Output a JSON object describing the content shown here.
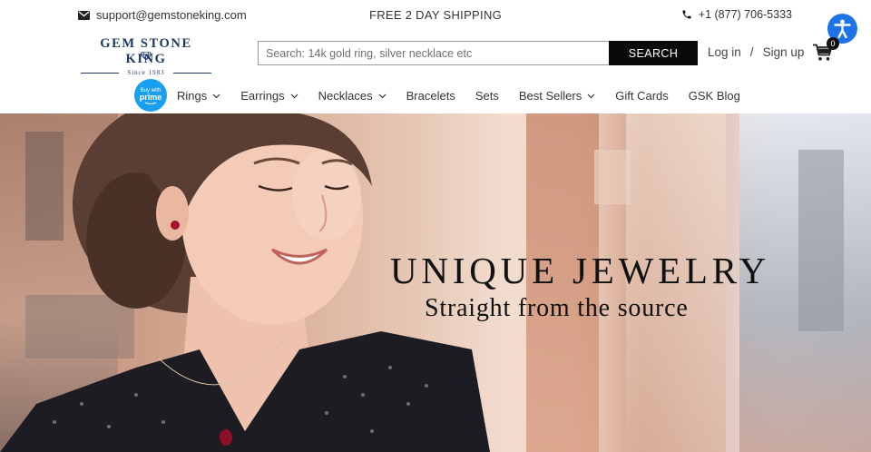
{
  "topbar": {
    "email": "support@gemstoneking.com",
    "shipping": "FREE 2 DAY SHIPPING",
    "phone": "+1 (877) 706-5333"
  },
  "logo": {
    "name": "GEM STONE KING",
    "since": "Since 1983"
  },
  "search": {
    "placeholder": "Search: 14k gold ring, silver necklace etc",
    "button": "SEARCH"
  },
  "account": {
    "login": "Log in",
    "separator": "/",
    "signup": "Sign up",
    "cart_count": "0"
  },
  "nav": {
    "prime_badge_top": "Buy with",
    "prime_badge_word": "prime",
    "items": [
      {
        "label": "Rings",
        "dropdown": true
      },
      {
        "label": "Earrings",
        "dropdown": true
      },
      {
        "label": "Necklaces",
        "dropdown": true
      },
      {
        "label": "Bracelets",
        "dropdown": false
      },
      {
        "label": "Sets",
        "dropdown": false
      },
      {
        "label": "Best Sellers",
        "dropdown": true
      },
      {
        "label": "Gift Cards",
        "dropdown": false
      },
      {
        "label": "GSK Blog",
        "dropdown": false
      }
    ]
  },
  "hero": {
    "headline": "UNIQUE JEWELRY",
    "subheadline": "Straight from the source"
  },
  "icons": {
    "email": "envelope-icon",
    "phone": "phone-icon",
    "cart": "cart-icon",
    "accessibility": "accessibility-icon",
    "dropdown": "chevron-down-icon"
  },
  "colors": {
    "brand_navy": "#1e3a63",
    "search_button": "#0a0a0a",
    "prime_blue": "#1a9ff0",
    "accessibility_blue": "#1e73e8"
  }
}
